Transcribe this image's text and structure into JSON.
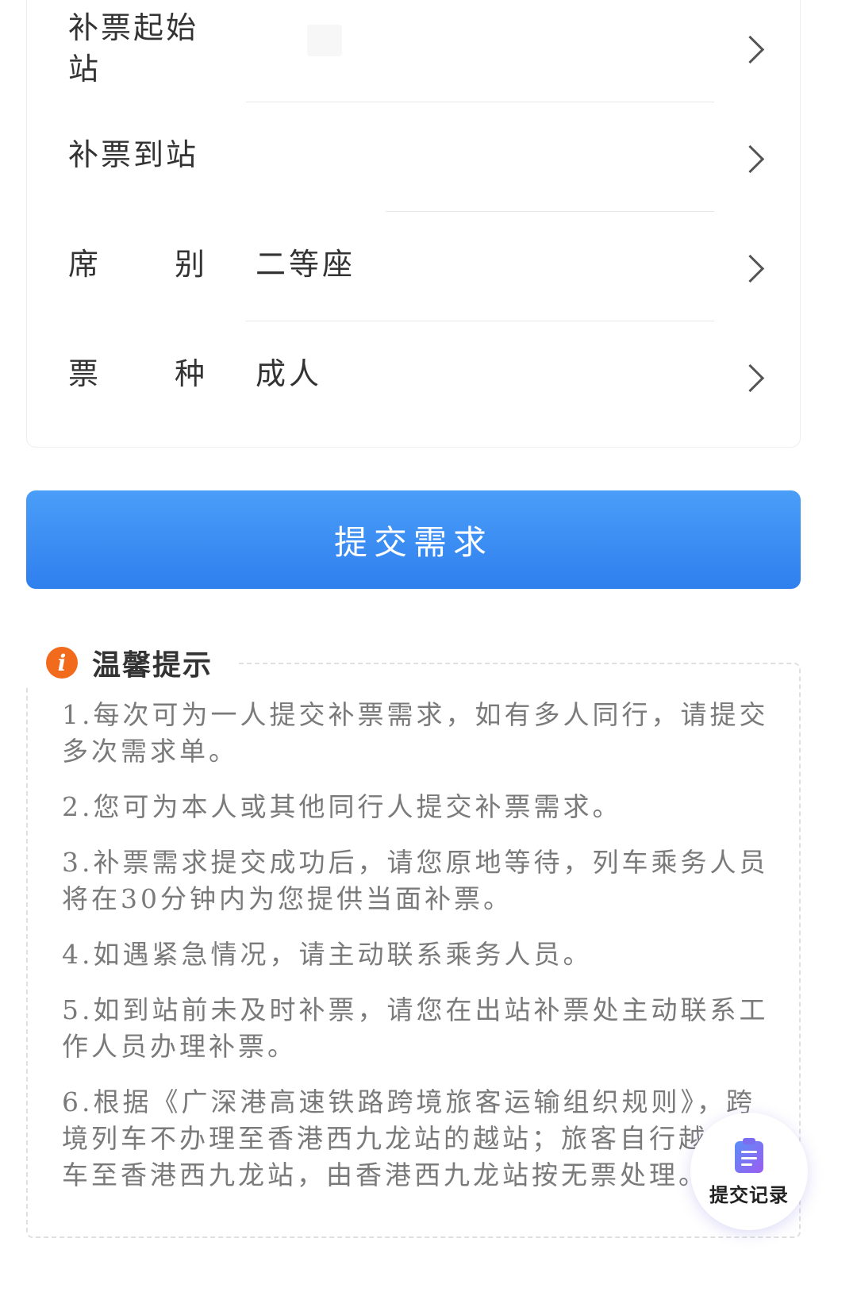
{
  "form": {
    "rows": [
      {
        "label": "补票起始站",
        "value": ""
      },
      {
        "label": "补票到站",
        "value": ""
      },
      {
        "label_parts": [
          "席",
          "别"
        ],
        "value": "二等座"
      },
      {
        "label_parts": [
          "票",
          "种"
        ],
        "value": "成人"
      }
    ]
  },
  "submit": {
    "label": "提交需求"
  },
  "tips": {
    "title": "温馨提示",
    "icon": "info-icon",
    "items": [
      "1.每次可为一人提交补票需求，如有多人同行，请提交多次需求单。",
      "2.您可为本人或其他同行人提交补票需求。",
      "3.补票需求提交成功后，请您原地等待，列车乘务人员将在30分钟内为您提供当面补票。",
      "4.如遇紧急情况，请主动联系乘务人员。",
      "5.如到站前未及时补票，请您在出站补票处主动联系工作人员办理补票。",
      "6.根据《广深港高速铁路跨境旅客运输组织规则》，跨境列车不办理至香港西九龙站的越站；旅客自行越站乘车至香港西九龙站，由香港西九龙站按无票处理。"
    ]
  },
  "fab": {
    "label": "提交记录",
    "icon": "clipboard-icon"
  },
  "colors": {
    "primary": "#3b8ef5",
    "info_orange": "#f26a1b",
    "fab_icon": "#7b6cf0"
  }
}
